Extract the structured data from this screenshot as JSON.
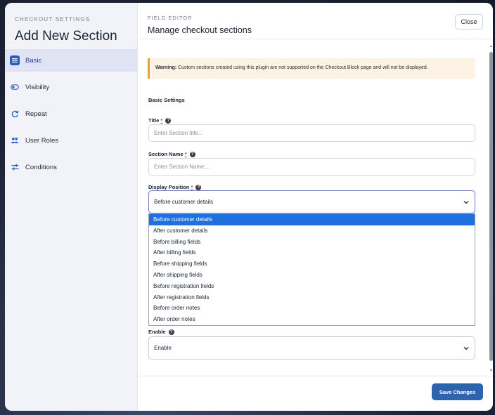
{
  "sidebar": {
    "eyebrow": "CHECKOUT SETTINGS",
    "title": "Add New Section",
    "items": [
      {
        "label": "Basic",
        "icon": "list-icon",
        "active": true
      },
      {
        "label": "Visibility",
        "icon": "toggle-icon"
      },
      {
        "label": "Repeat",
        "icon": "refresh-icon"
      },
      {
        "label": "User Roles",
        "icon": "users-icon"
      },
      {
        "label": "Conditions",
        "icon": "sliders-icon"
      }
    ]
  },
  "header": {
    "eyebrow": "FIELD EDITOR",
    "title": "Manage checkout sections",
    "close_label": "Close"
  },
  "warning": {
    "bold": "Warning:",
    "text": " Custom sections created using this plugin are not supported on the Checkout Block page and will not be displayed."
  },
  "basic_settings": {
    "title": "Basic Settings",
    "title_field": {
      "label": "Title",
      "required": "*",
      "placeholder": "Enter Section title..."
    },
    "name_field": {
      "label": "Section Name",
      "required": "*",
      "placeholder": "Enter Section Name..."
    },
    "position_field": {
      "label": "Display Position",
      "required": "*",
      "value": "Before customer details",
      "options": [
        "Before customer details",
        "After customer details",
        "Before billing fields",
        "After billing fields",
        "Before shipping fields",
        "After shipping fields",
        "Before registration fields",
        "After registration fields",
        "Before order notes",
        "After order notes"
      ]
    },
    "enable_field": {
      "label": "Enable",
      "value": "Enable"
    }
  },
  "footer": {
    "save_label": "Save Changes"
  },
  "colors": {
    "accent": "#2b59c3",
    "save": "#2e64ad",
    "selected_option": "#1f6fe0",
    "warning_border": "#e8a33c"
  }
}
